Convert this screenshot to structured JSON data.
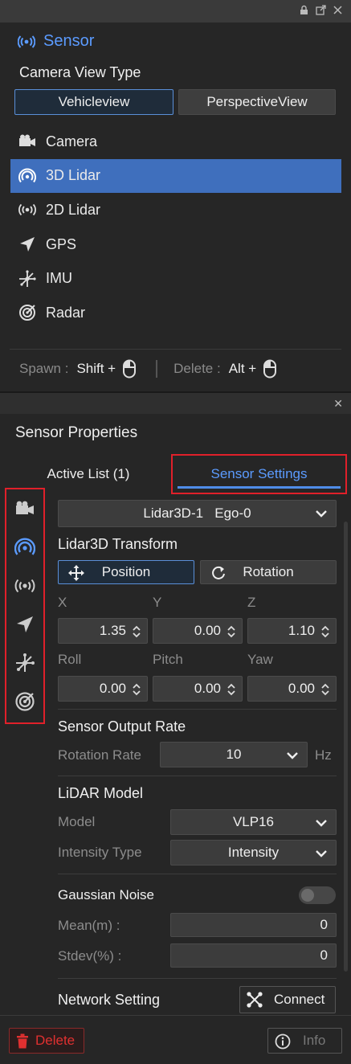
{
  "sensor_panel": {
    "title": "Sensor",
    "camera_view_type_label": "Camera View Type",
    "view_buttons": [
      "Vehicleview",
      "PerspectiveView"
    ],
    "sensors": [
      {
        "label": "Camera",
        "icon": "camera-icon"
      },
      {
        "label": "3D Lidar",
        "icon": "lidar-3d-icon",
        "selected": true
      },
      {
        "label": "2D Lidar",
        "icon": "lidar-2d-icon"
      },
      {
        "label": "GPS",
        "icon": "gps-icon"
      },
      {
        "label": "IMU",
        "icon": "imu-icon"
      },
      {
        "label": "Radar",
        "icon": "radar-icon"
      }
    ],
    "spawn_label": "Spawn :",
    "spawn_key": "Shift +",
    "delete_label": "Delete :",
    "delete_key": "Alt +"
  },
  "properties_panel": {
    "title": "Sensor Properties",
    "tabs": {
      "active_list": "Active List  (1)",
      "sensor_settings": "Sensor Settings"
    },
    "sensor_select": "Lidar3D-1   Ego-0",
    "transform": {
      "title": "Lidar3D Transform",
      "position_button": "Position",
      "rotation_button": "Rotation",
      "x_label": "X",
      "y_label": "Y",
      "z_label": "Z",
      "x": "1.35",
      "y": "0.00",
      "z": "1.10",
      "roll_label": "Roll",
      "pitch_label": "Pitch",
      "yaw_label": "Yaw",
      "roll": "0.00",
      "pitch": "0.00",
      "yaw": "0.00"
    },
    "output_rate": {
      "title": "Sensor Output Rate",
      "rotation_rate_label": "Rotation Rate",
      "rotation_rate_value": "10",
      "unit": "Hz"
    },
    "lidar_model": {
      "title": "LiDAR Model",
      "model_label": "Model",
      "model_value": "VLP16",
      "intensity_label": "Intensity Type",
      "intensity_value": "Intensity"
    },
    "noise": {
      "title": "Gaussian Noise",
      "enabled": false,
      "mean_label": "Mean(m) :",
      "mean_value": "0",
      "stdev_label": "Stdev(%) :",
      "stdev_value": "0"
    },
    "network": {
      "title": "Network Setting",
      "connect_button": "Connect"
    },
    "footer": {
      "delete_button": "Delete",
      "info_button": "Info"
    }
  },
  "colors": {
    "accent": "#5b9bff",
    "selected_row": "#3f6fbd",
    "danger": "#e03030",
    "highlight_box": "#e0202a"
  }
}
